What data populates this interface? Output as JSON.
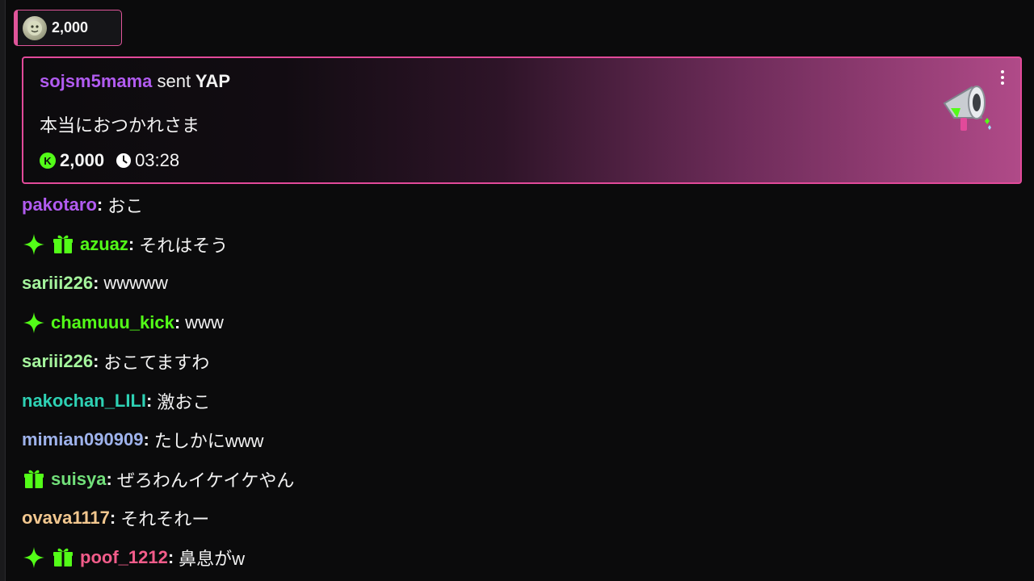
{
  "pinned": {
    "amount": "2,000",
    "accent": "#e0559a"
  },
  "yap": {
    "sender": "sojsm5mama",
    "sent_text": "sent",
    "gift_name": "YAP",
    "message": "本当におつかれさま",
    "amount": "2,000",
    "time": "03:28",
    "coin_glyph": "K",
    "sender_color": "#b15bf0",
    "border_color": "#e24a9a",
    "icon": "megaphone-icon"
  },
  "chat": [
    {
      "user": "pakotaro",
      "color": "#b15bf0",
      "badges": [],
      "message": "おこ"
    },
    {
      "user": "azuaz",
      "color": "#53fc18",
      "badges": [
        "sparkle",
        "gift"
      ],
      "message": "それはそう"
    },
    {
      "user": "sariii226",
      "color": "#a5f59d",
      "badges": [],
      "message": "wwwww"
    },
    {
      "user": "chamuuu_kick",
      "color": "#53fc18",
      "badges": [
        "sparkle"
      ],
      "message": "www"
    },
    {
      "user": "sariii226",
      "color": "#a5f59d",
      "badges": [],
      "message": "おこてますわ"
    },
    {
      "user": "nakochan_LILI",
      "color": "#2ed1b4",
      "badges": [],
      "message": "激おこ"
    },
    {
      "user": "mimian090909",
      "color": "#9fb3ec",
      "badges": [],
      "message": "たしかにwww"
    },
    {
      "user": "suisya",
      "color": "#72e07a",
      "badges": [
        "gift"
      ],
      "message": "ぜろわんイケイケやん"
    },
    {
      "user": "ovava1117",
      "color": "#f2c78f",
      "badges": [],
      "message": "それそれー"
    },
    {
      "user": "poof_1212",
      "color": "#f25c8a",
      "badges": [
        "sparkle",
        "gift"
      ],
      "message": "鼻息がw"
    }
  ],
  "colors": {
    "background": "#0b0b0c",
    "kick_green": "#53fc18"
  }
}
